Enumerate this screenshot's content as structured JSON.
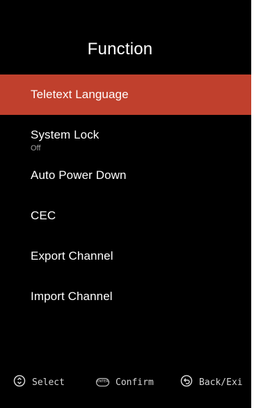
{
  "screen": {
    "title": "Function"
  },
  "menu": {
    "items": [
      {
        "label": "Teletext Language",
        "sub": "",
        "selected": true
      },
      {
        "label": "System Lock",
        "sub": "Off",
        "selected": false
      },
      {
        "label": "Auto Power Down",
        "sub": "",
        "selected": false
      },
      {
        "label": "CEC",
        "sub": "",
        "selected": false
      },
      {
        "label": "Export Channel",
        "sub": "",
        "selected": false
      },
      {
        "label": "Import Channel",
        "sub": "",
        "selected": false
      }
    ]
  },
  "footer": {
    "select_label": "Select",
    "confirm_label": "Confirm",
    "back_label": "Back/Exi",
    "enter_icon_text": "ENTER"
  },
  "colors": {
    "background": "#000000",
    "highlight": "#c0402d",
    "text": "#ffffff",
    "subtext": "#a0a0a0"
  }
}
